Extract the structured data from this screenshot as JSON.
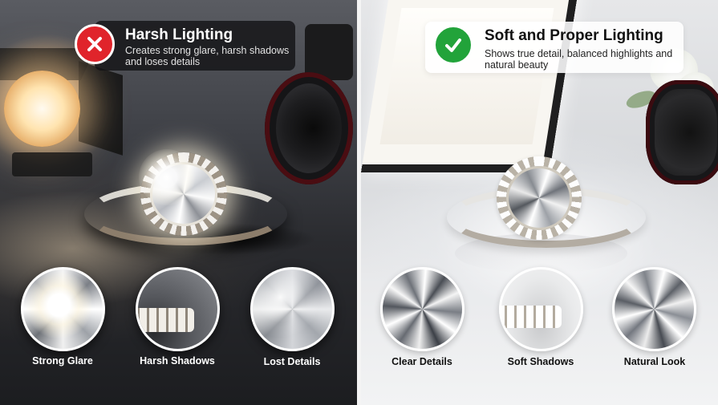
{
  "left_panel": {
    "title": "Harsh Lighting",
    "description": "Creates strong glare, harsh shadows and loses details",
    "badge_icon": "cross-icon",
    "badge_color": "#e0242b",
    "details": [
      {
        "label": "Strong Glare"
      },
      {
        "label": "Harsh Shadows"
      },
      {
        "label": "Lost Details"
      }
    ]
  },
  "right_panel": {
    "title": "Soft and Proper Lighting",
    "description": "Shows true detail, balanced highlights and natural beauty",
    "badge_icon": "checkmark-icon",
    "badge_color": "#22a33a",
    "details": [
      {
        "label": "Clear Details"
      },
      {
        "label": "Soft Shadows"
      },
      {
        "label": "Natural Look"
      }
    ]
  }
}
